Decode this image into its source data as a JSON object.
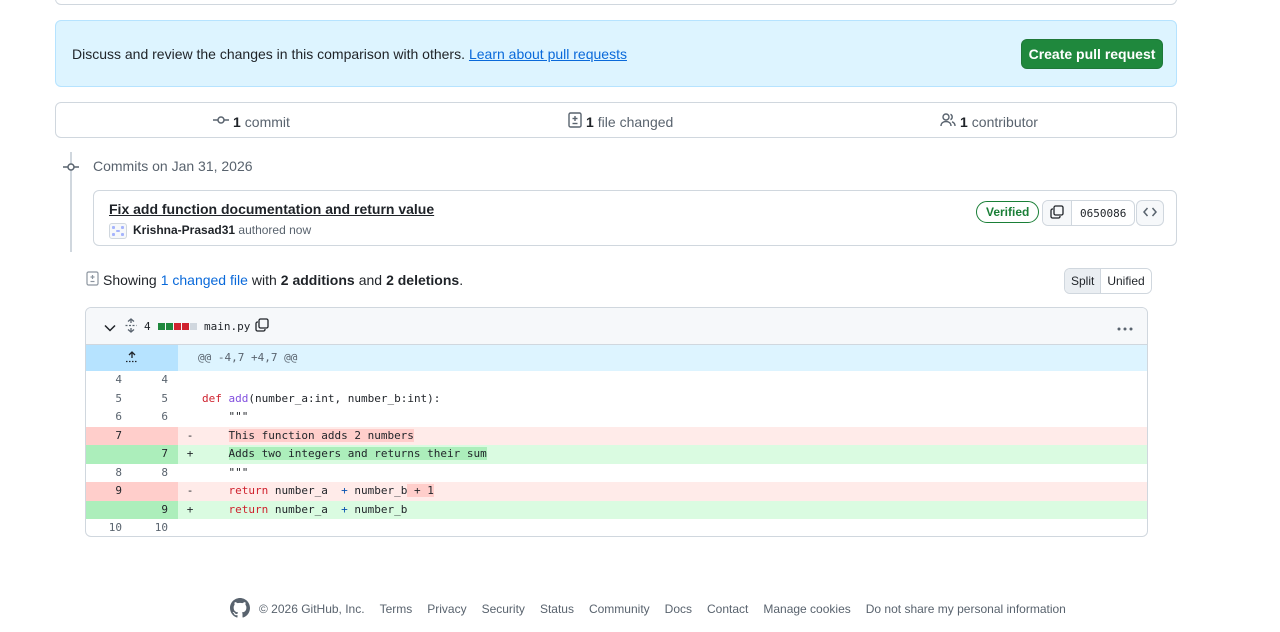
{
  "banner": {
    "text": "Discuss and review the changes in this comparison with others.",
    "link": "Learn about pull requests",
    "button": "Create pull request"
  },
  "stats": {
    "commits_count": "1",
    "commits_label": "commit",
    "files_count": "1",
    "files_label": "file changed",
    "contributors_count": "1",
    "contributors_label": "contributor"
  },
  "commits": {
    "heading": "Commits on Jan 31, 2026",
    "items": [
      {
        "title": "Fix add function documentation and return value",
        "author": "Krishna-Prasad31",
        "when": "authored now",
        "badge": "Verified",
        "sha": "0650086"
      }
    ]
  },
  "summary": {
    "prefix": "Showing",
    "files_link": "1 changed file",
    "with": "with",
    "additions": "2 additions",
    "and": "and",
    "deletions": "2 deletions",
    "period": "."
  },
  "view": {
    "split": "Split",
    "unified": "Unified"
  },
  "diff": {
    "changes_count": "4",
    "filename": "main.py",
    "hunk_header": "@@ -4,7 +4,7 @@",
    "lines": [
      {
        "type": "ctx",
        "old": "4",
        "new": "4",
        "sign": "",
        "code": ""
      },
      {
        "type": "ctx",
        "old": "5",
        "new": "5",
        "sign": "",
        "code": "def add(number_a:int, number_b:int):"
      },
      {
        "type": "ctx",
        "old": "6",
        "new": "6",
        "sign": "",
        "code": "    \"\"\""
      },
      {
        "type": "del",
        "old": "7",
        "new": "",
        "sign": "-",
        "code": "    This function adds 2 numbers"
      },
      {
        "type": "add",
        "old": "",
        "new": "7",
        "sign": "+",
        "code": "    Adds two integers and returns their sum"
      },
      {
        "type": "ctx",
        "old": "8",
        "new": "8",
        "sign": "",
        "code": "    \"\"\""
      },
      {
        "type": "del",
        "old": "9",
        "new": "",
        "sign": "-",
        "code": "    return number_a  + number_b + 1"
      },
      {
        "type": "add",
        "old": "",
        "new": "9",
        "sign": "+",
        "code": "    return number_a  + number_b"
      },
      {
        "type": "ctx",
        "old": "10",
        "new": "10",
        "sign": "",
        "code": ""
      }
    ]
  },
  "footer": {
    "copyright": "© 2026 GitHub, Inc.",
    "links": [
      "Terms",
      "Privacy",
      "Security",
      "Status",
      "Community",
      "Docs",
      "Contact",
      "Manage cookies",
      "Do not share my personal information"
    ]
  },
  "colors": {
    "primary_button": "#1f883d",
    "link": "#0969da",
    "banner_bg": "#ddf4ff",
    "deletion": "#ffebe9",
    "addition": "#dafbe1",
    "verified": "#1a7f37"
  },
  "icons": [
    "git-commit-icon",
    "file-diff-icon",
    "people-icon",
    "copy-icon",
    "code-icon",
    "chevron-down-icon",
    "expand-icon",
    "kebab-icon",
    "github-logo-icon",
    "expand-up-icon"
  ]
}
